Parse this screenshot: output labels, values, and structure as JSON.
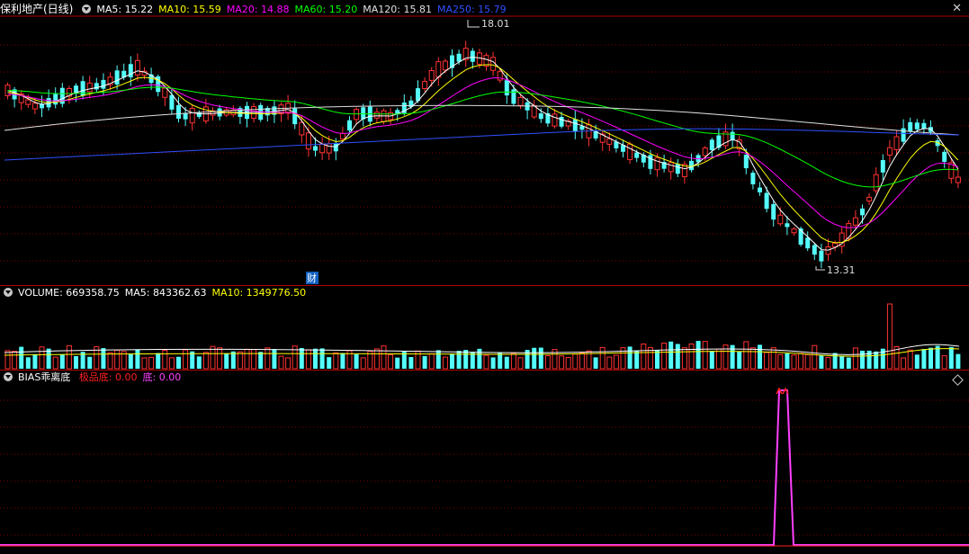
{
  "main_panel": {
    "title": "保利地产(日线)",
    "ma_labels": [
      {
        "text": "MA5: 15.22",
        "color": "#ffffff"
      },
      {
        "text": "MA10: 15.59",
        "color": "#ffff00"
      },
      {
        "text": "MA20: 14.88",
        "color": "#ff00ff"
      },
      {
        "text": "MA60: 15.20",
        "color": "#00ff00"
      },
      {
        "text": "MA120: 15.81",
        "color": "#e0e0e0"
      },
      {
        "text": "MA250: 15.79",
        "color": "#3050ff"
      }
    ],
    "high_label": "18.01",
    "low_label": "13.31",
    "fin_marker": "财",
    "close_icon": "close-icon"
  },
  "volume_panel": {
    "labels": [
      {
        "text": "VOLUME: 669358.75",
        "color": "#ffffff"
      },
      {
        "text": "MA5: 843362.63",
        "color": "#ffffff"
      },
      {
        "text": "MA10: 1349776.50",
        "color": "#ffff00"
      }
    ]
  },
  "bias_panel": {
    "title": "BIAS乖离底",
    "labels": [
      {
        "text": "极品底: 0.00",
        "color": "#ff2020"
      },
      {
        "text": "底: 0.00",
        "color": "#ff40ff"
      }
    ]
  },
  "colors": {
    "up": "#ff3232",
    "down": "#54fcfc",
    "grid": "#800000",
    "border": "#b00000"
  }
}
